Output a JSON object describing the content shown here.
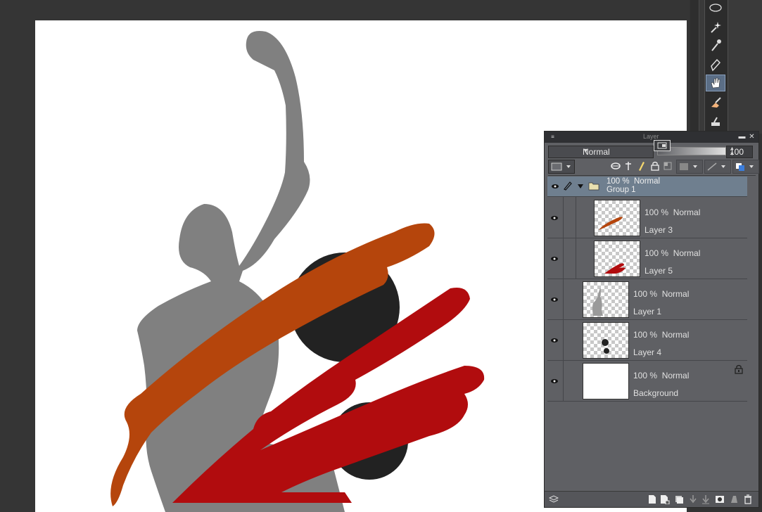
{
  "panel": {
    "title": "Layer",
    "blend_mode": "Normal",
    "opacity_value": "100"
  },
  "layers": [
    {
      "opacity": "100 %",
      "mode": "Normal",
      "name": "Group 1"
    },
    {
      "opacity": "100 %",
      "mode": "Normal",
      "name": "Layer 3"
    },
    {
      "opacity": "100 %",
      "mode": "Normal",
      "name": "Layer 5"
    },
    {
      "opacity": "100 %",
      "mode": "Normal",
      "name": "Layer 1"
    },
    {
      "opacity": "100 %",
      "mode": "Normal",
      "name": "Layer 4"
    },
    {
      "opacity": "100 %",
      "mode": "Normal",
      "name": "Background",
      "locked": true
    }
  ],
  "tools": [
    "lasso-icon",
    "magic-wand-icon",
    "eyedropper-icon",
    "pen-icon",
    "hand-icon",
    "eraser-icon",
    "stamp-icon"
  ],
  "colors": {
    "orange_stroke": "#b5450c",
    "red_stroke": "#b10c0e",
    "figure_gray": "#808080",
    "dark_circle": "#222222",
    "panel_bg": "#5f6064",
    "selected_group": "#6f7f8f"
  }
}
